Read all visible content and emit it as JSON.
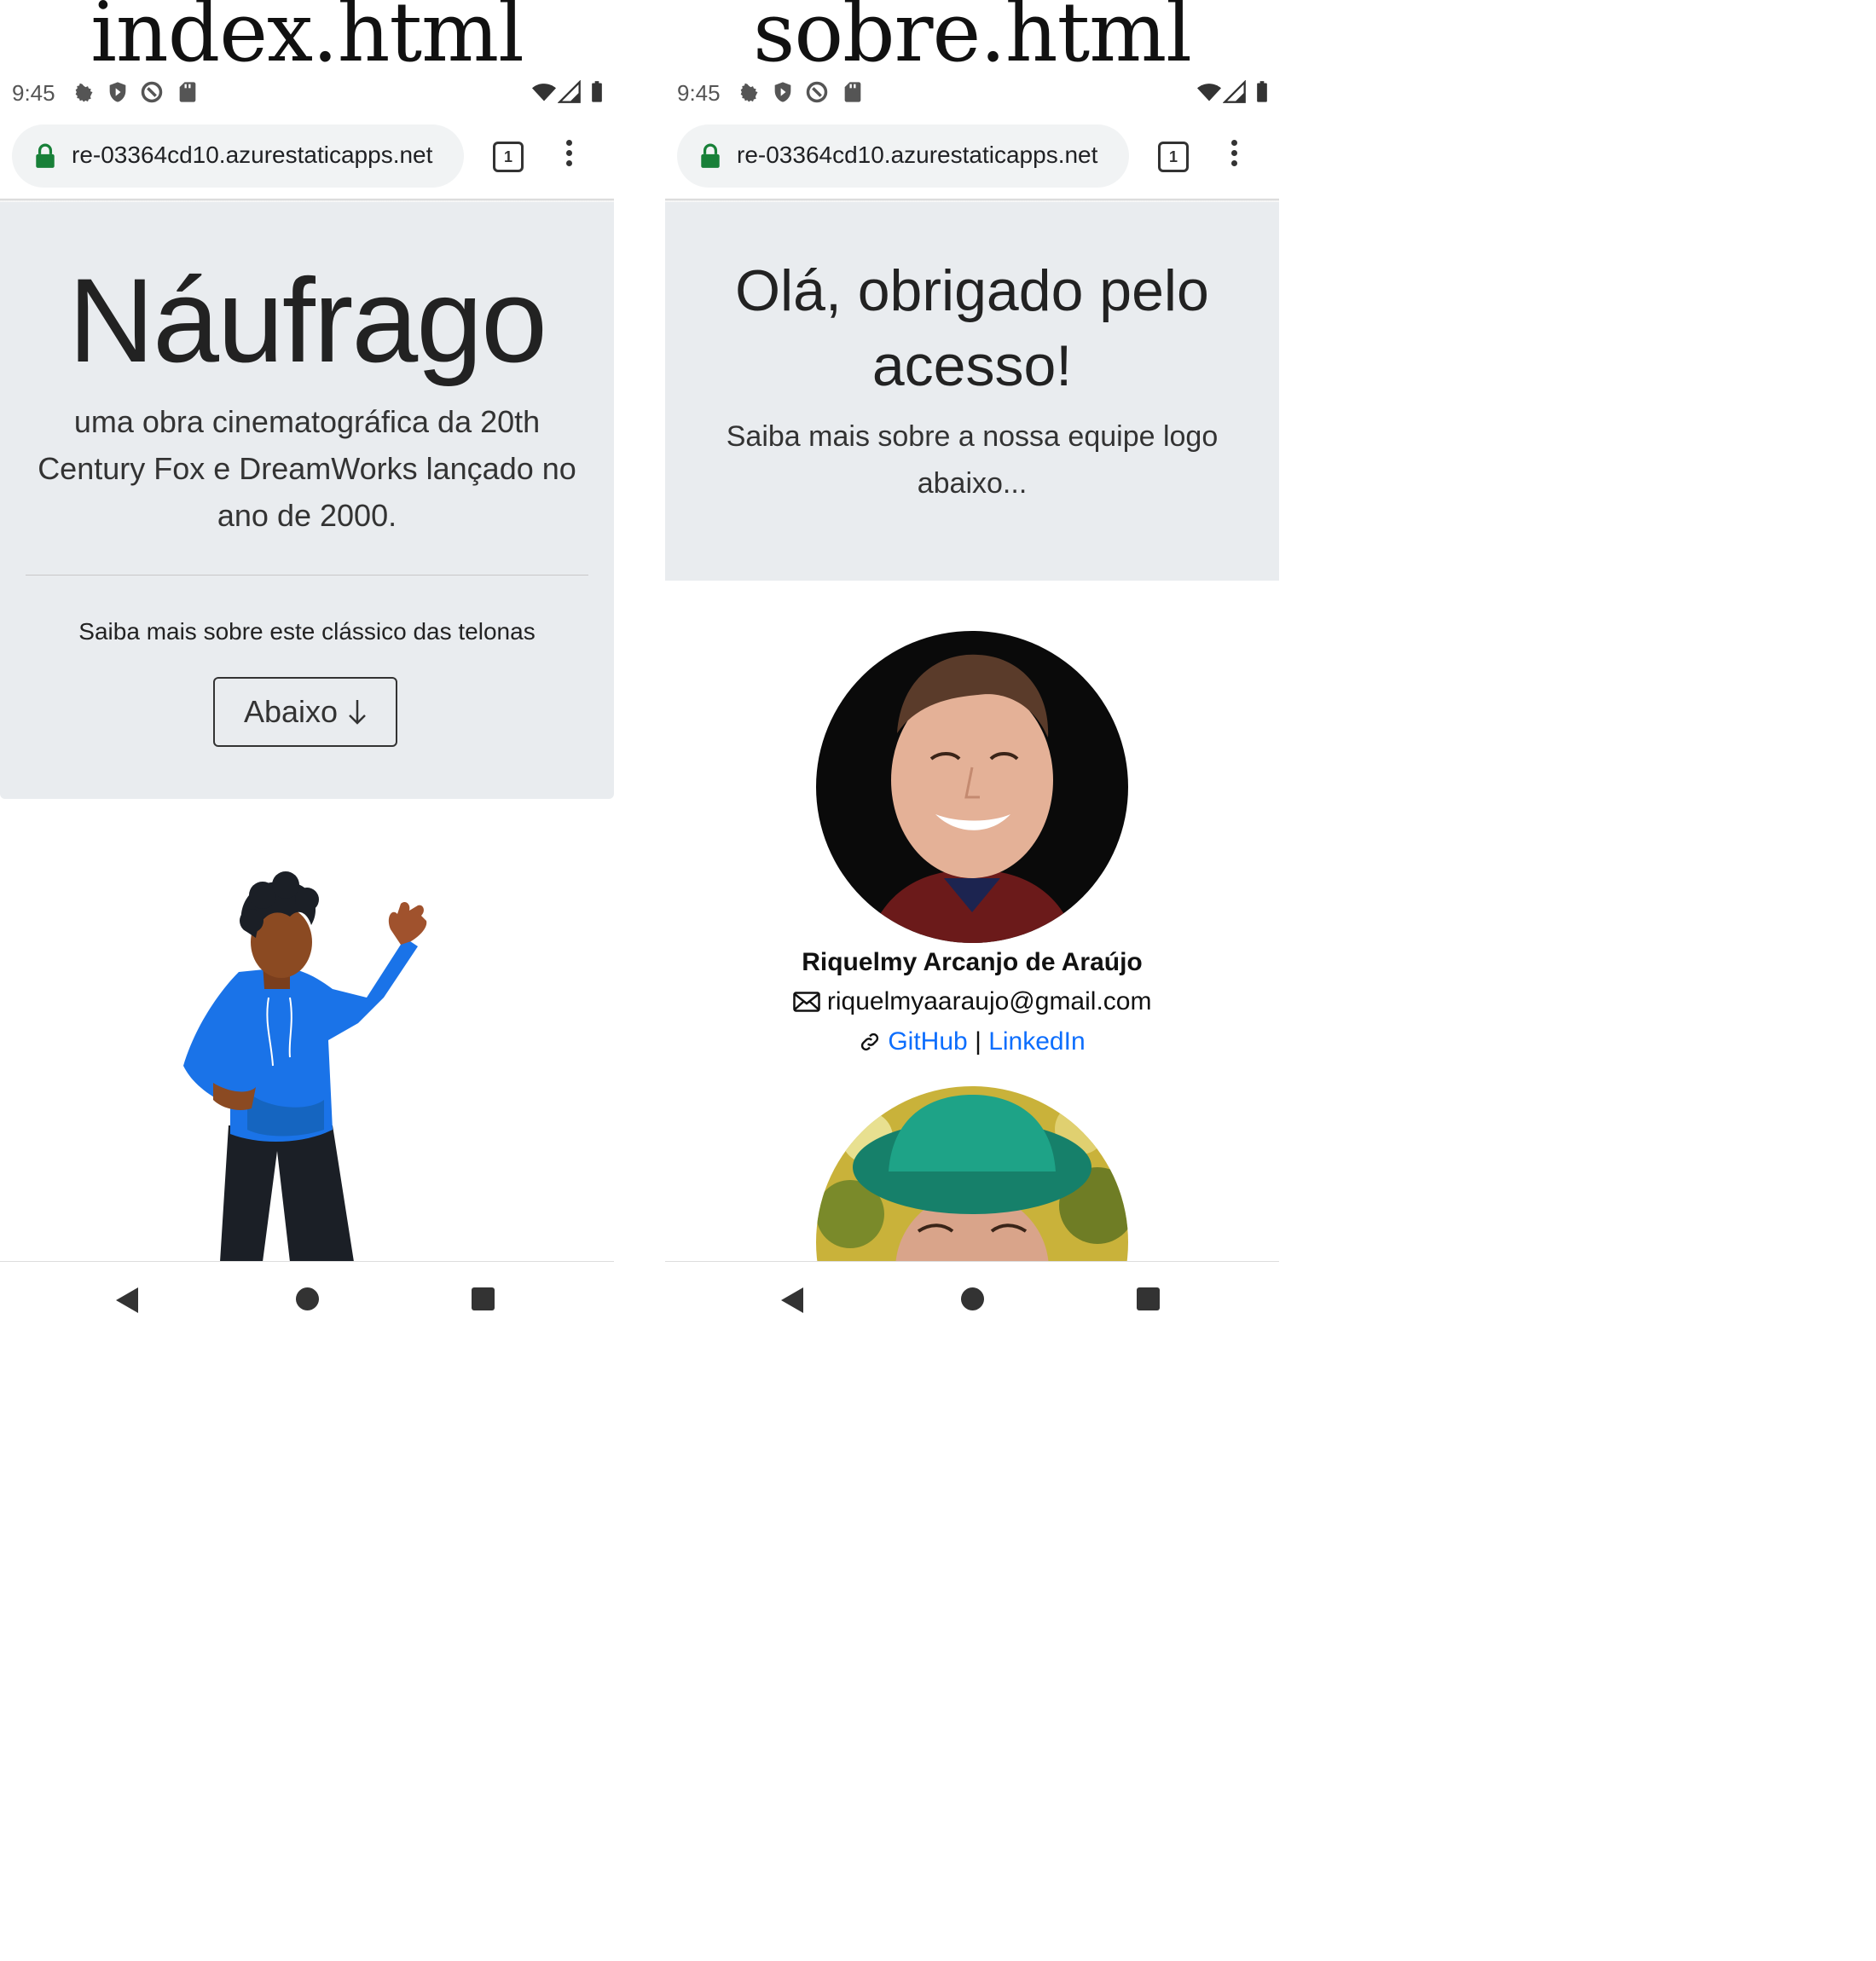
{
  "captions": {
    "left": "index.html",
    "right": "sobre.html"
  },
  "status_bar": {
    "time": "9:45"
  },
  "browser": {
    "url": "re-03364cd10.azurestaticapps.net",
    "tab_count": "1"
  },
  "index": {
    "title": "Náufrago",
    "lead": "uma obra cinematográfica da 20th Century Fox e DreamWorks lançado no ano de 2000.",
    "more_text": "Saiba mais sobre este clássico das telonas",
    "button_label": "Abaixo"
  },
  "sobre": {
    "title": "Olá, obrigado pelo acesso!",
    "lead": "Saiba mais sobre a nossa equipe logo abaixo...",
    "person": {
      "name": "Riquelmy Arcanjo de Araújo",
      "email": "riquelmyaaraujo@gmail.com",
      "github_label": "GitHub",
      "separator": "|",
      "linkedin_label": "LinkedIn"
    }
  },
  "colors": {
    "jumbotron": "#e9ecef",
    "link": "#0d6efd",
    "lock": "#188038",
    "hoodie": "#1a73e8"
  }
}
